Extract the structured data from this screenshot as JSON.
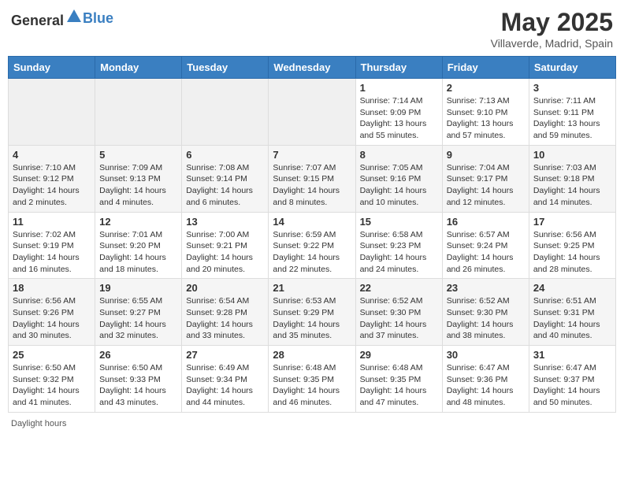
{
  "header": {
    "logo_general": "General",
    "logo_blue": "Blue",
    "title": "May 2025",
    "location": "Villaverde, Madrid, Spain"
  },
  "days_of_week": [
    "Sunday",
    "Monday",
    "Tuesday",
    "Wednesday",
    "Thursday",
    "Friday",
    "Saturday"
  ],
  "footer_text": "Daylight hours",
  "weeks": [
    [
      {
        "day": "",
        "sunrise": "",
        "sunset": "",
        "daylight": "",
        "empty": true
      },
      {
        "day": "",
        "sunrise": "",
        "sunset": "",
        "daylight": "",
        "empty": true
      },
      {
        "day": "",
        "sunrise": "",
        "sunset": "",
        "daylight": "",
        "empty": true
      },
      {
        "day": "",
        "sunrise": "",
        "sunset": "",
        "daylight": "",
        "empty": true
      },
      {
        "day": "1",
        "sunrise": "Sunrise: 7:14 AM",
        "sunset": "Sunset: 9:09 PM",
        "daylight": "Daylight: 13 hours and 55 minutes."
      },
      {
        "day": "2",
        "sunrise": "Sunrise: 7:13 AM",
        "sunset": "Sunset: 9:10 PM",
        "daylight": "Daylight: 13 hours and 57 minutes."
      },
      {
        "day": "3",
        "sunrise": "Sunrise: 7:11 AM",
        "sunset": "Sunset: 9:11 PM",
        "daylight": "Daylight: 13 hours and 59 minutes."
      }
    ],
    [
      {
        "day": "4",
        "sunrise": "Sunrise: 7:10 AM",
        "sunset": "Sunset: 9:12 PM",
        "daylight": "Daylight: 14 hours and 2 minutes."
      },
      {
        "day": "5",
        "sunrise": "Sunrise: 7:09 AM",
        "sunset": "Sunset: 9:13 PM",
        "daylight": "Daylight: 14 hours and 4 minutes."
      },
      {
        "day": "6",
        "sunrise": "Sunrise: 7:08 AM",
        "sunset": "Sunset: 9:14 PM",
        "daylight": "Daylight: 14 hours and 6 minutes."
      },
      {
        "day": "7",
        "sunrise": "Sunrise: 7:07 AM",
        "sunset": "Sunset: 9:15 PM",
        "daylight": "Daylight: 14 hours and 8 minutes."
      },
      {
        "day": "8",
        "sunrise": "Sunrise: 7:05 AM",
        "sunset": "Sunset: 9:16 PM",
        "daylight": "Daylight: 14 hours and 10 minutes."
      },
      {
        "day": "9",
        "sunrise": "Sunrise: 7:04 AM",
        "sunset": "Sunset: 9:17 PM",
        "daylight": "Daylight: 14 hours and 12 minutes."
      },
      {
        "day": "10",
        "sunrise": "Sunrise: 7:03 AM",
        "sunset": "Sunset: 9:18 PM",
        "daylight": "Daylight: 14 hours and 14 minutes."
      }
    ],
    [
      {
        "day": "11",
        "sunrise": "Sunrise: 7:02 AM",
        "sunset": "Sunset: 9:19 PM",
        "daylight": "Daylight: 14 hours and 16 minutes."
      },
      {
        "day": "12",
        "sunrise": "Sunrise: 7:01 AM",
        "sunset": "Sunset: 9:20 PM",
        "daylight": "Daylight: 14 hours and 18 minutes."
      },
      {
        "day": "13",
        "sunrise": "Sunrise: 7:00 AM",
        "sunset": "Sunset: 9:21 PM",
        "daylight": "Daylight: 14 hours and 20 minutes."
      },
      {
        "day": "14",
        "sunrise": "Sunrise: 6:59 AM",
        "sunset": "Sunset: 9:22 PM",
        "daylight": "Daylight: 14 hours and 22 minutes."
      },
      {
        "day": "15",
        "sunrise": "Sunrise: 6:58 AM",
        "sunset": "Sunset: 9:23 PM",
        "daylight": "Daylight: 14 hours and 24 minutes."
      },
      {
        "day": "16",
        "sunrise": "Sunrise: 6:57 AM",
        "sunset": "Sunset: 9:24 PM",
        "daylight": "Daylight: 14 hours and 26 minutes."
      },
      {
        "day": "17",
        "sunrise": "Sunrise: 6:56 AM",
        "sunset": "Sunset: 9:25 PM",
        "daylight": "Daylight: 14 hours and 28 minutes."
      }
    ],
    [
      {
        "day": "18",
        "sunrise": "Sunrise: 6:56 AM",
        "sunset": "Sunset: 9:26 PM",
        "daylight": "Daylight: 14 hours and 30 minutes."
      },
      {
        "day": "19",
        "sunrise": "Sunrise: 6:55 AM",
        "sunset": "Sunset: 9:27 PM",
        "daylight": "Daylight: 14 hours and 32 minutes."
      },
      {
        "day": "20",
        "sunrise": "Sunrise: 6:54 AM",
        "sunset": "Sunset: 9:28 PM",
        "daylight": "Daylight: 14 hours and 33 minutes."
      },
      {
        "day": "21",
        "sunrise": "Sunrise: 6:53 AM",
        "sunset": "Sunset: 9:29 PM",
        "daylight": "Daylight: 14 hours and 35 minutes."
      },
      {
        "day": "22",
        "sunrise": "Sunrise: 6:52 AM",
        "sunset": "Sunset: 9:30 PM",
        "daylight": "Daylight: 14 hours and 37 minutes."
      },
      {
        "day": "23",
        "sunrise": "Sunrise: 6:52 AM",
        "sunset": "Sunset: 9:30 PM",
        "daylight": "Daylight: 14 hours and 38 minutes."
      },
      {
        "day": "24",
        "sunrise": "Sunrise: 6:51 AM",
        "sunset": "Sunset: 9:31 PM",
        "daylight": "Daylight: 14 hours and 40 minutes."
      }
    ],
    [
      {
        "day": "25",
        "sunrise": "Sunrise: 6:50 AM",
        "sunset": "Sunset: 9:32 PM",
        "daylight": "Daylight: 14 hours and 41 minutes."
      },
      {
        "day": "26",
        "sunrise": "Sunrise: 6:50 AM",
        "sunset": "Sunset: 9:33 PM",
        "daylight": "Daylight: 14 hours and 43 minutes."
      },
      {
        "day": "27",
        "sunrise": "Sunrise: 6:49 AM",
        "sunset": "Sunset: 9:34 PM",
        "daylight": "Daylight: 14 hours and 44 minutes."
      },
      {
        "day": "28",
        "sunrise": "Sunrise: 6:48 AM",
        "sunset": "Sunset: 9:35 PM",
        "daylight": "Daylight: 14 hours and 46 minutes."
      },
      {
        "day": "29",
        "sunrise": "Sunrise: 6:48 AM",
        "sunset": "Sunset: 9:35 PM",
        "daylight": "Daylight: 14 hours and 47 minutes."
      },
      {
        "day": "30",
        "sunrise": "Sunrise: 6:47 AM",
        "sunset": "Sunset: 9:36 PM",
        "daylight": "Daylight: 14 hours and 48 minutes."
      },
      {
        "day": "31",
        "sunrise": "Sunrise: 6:47 AM",
        "sunset": "Sunset: 9:37 PM",
        "daylight": "Daylight: 14 hours and 50 minutes."
      }
    ]
  ]
}
